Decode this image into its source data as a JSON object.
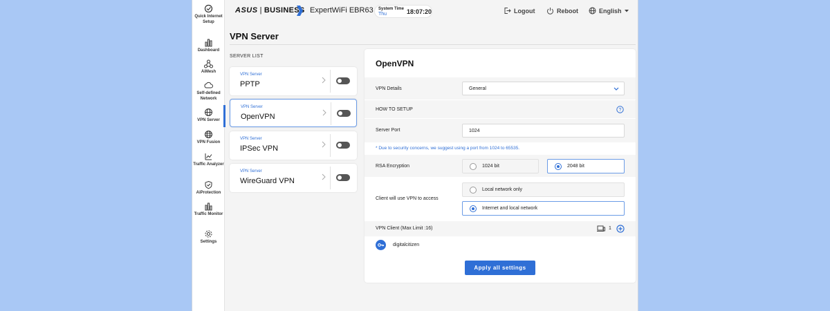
{
  "sidebar": {
    "items": [
      {
        "label": "Quick Internet Setup"
      },
      {
        "label": "Dashboard"
      },
      {
        "label": "AiMesh"
      },
      {
        "label": "Self-defined Network"
      },
      {
        "label": "VPN Server"
      },
      {
        "label": "VPN Fusion"
      },
      {
        "label": "Traffic Analyzer"
      },
      {
        "label": "AiProtection"
      },
      {
        "label": "Traffic Monitor"
      },
      {
        "label": "Settings"
      }
    ],
    "active": "VPN Server"
  },
  "header": {
    "brand": "ASUS",
    "separator": "|",
    "business": "BUSINESS",
    "model": "ExpertWiFi EBR63",
    "system_time_label": "System Time",
    "day": "Thu",
    "time": "18:07:20",
    "logout": "Logout",
    "reboot": "Reboot",
    "language": "English"
  },
  "page": {
    "title": "VPN Server",
    "list_label": "SERVER LIST"
  },
  "servers": [
    {
      "sub": "VPN Server",
      "name": "PPTP"
    },
    {
      "sub": "VPN Server",
      "name": "OpenVPN"
    },
    {
      "sub": "VPN Server",
      "name": "IPSec VPN"
    },
    {
      "sub": "VPN Server",
      "name": "WireGuard VPN"
    }
  ],
  "panel": {
    "title": "OpenVPN",
    "vpn_details_label": "VPN Details",
    "vpn_details_value": "General",
    "how_to_setup": "HOW TO SETUP",
    "server_port_label": "Server Port",
    "server_port_value": "1024",
    "port_note": "* Due to security concerns, we suggest using a port from 1024 to 65535.",
    "rsa_label": "RSA Encryption",
    "rsa_options": [
      "1024 bit",
      "2048 bit"
    ],
    "rsa_selected": "2048 bit",
    "access_label": "Client will use VPN to access",
    "access_options": [
      "Local network only",
      "Internet and local network"
    ],
    "access_selected": "Internet and local network",
    "client_label": "VPN Client (Max Limit :16)",
    "client_count": "1",
    "client_name": "digitalcitizen",
    "apply": "Apply all settings"
  },
  "colors": {
    "accent": "#2f6fd6",
    "background": "#a9c8f5"
  }
}
